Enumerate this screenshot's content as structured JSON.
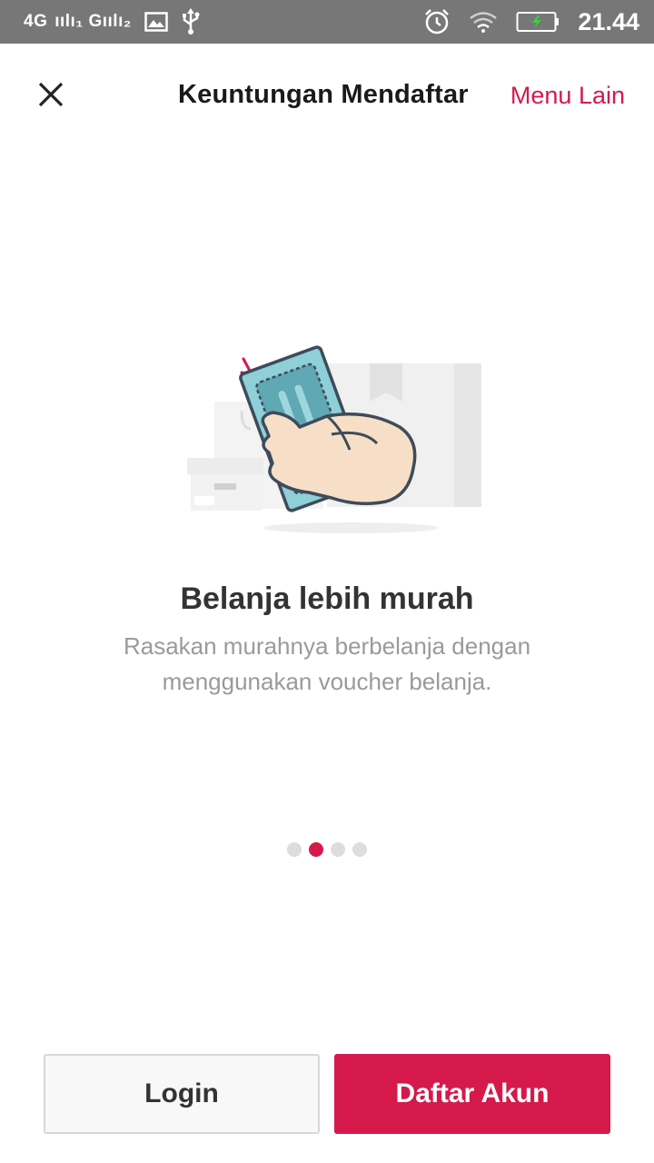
{
  "status_bar": {
    "network_label": "4G  ıılı₁ Gıılı₂",
    "time": "21.44",
    "icons": [
      "gallery-icon",
      "usb-icon",
      "alarm-icon",
      "wifi-icon",
      "battery-charging-icon"
    ]
  },
  "header": {
    "title": "Keuntungan Mendaftar",
    "menu_label": "Menu Lain",
    "close_icon": "close-icon"
  },
  "slide": {
    "title": "Belanja lebih murah",
    "description": "Rasakan murahnya berbelanja dengan menggunakan voucher belanja.",
    "illustration_icon": "hand-holding-voucher-illustration"
  },
  "pagination": {
    "total": 4,
    "active_index": 1
  },
  "actions": {
    "login_label": "Login",
    "register_label": "Daftar Akun"
  },
  "colors": {
    "accent": "#d6194b",
    "status_bar": "#777777",
    "title_text": "#333333",
    "muted_text": "#9a9a9a"
  }
}
